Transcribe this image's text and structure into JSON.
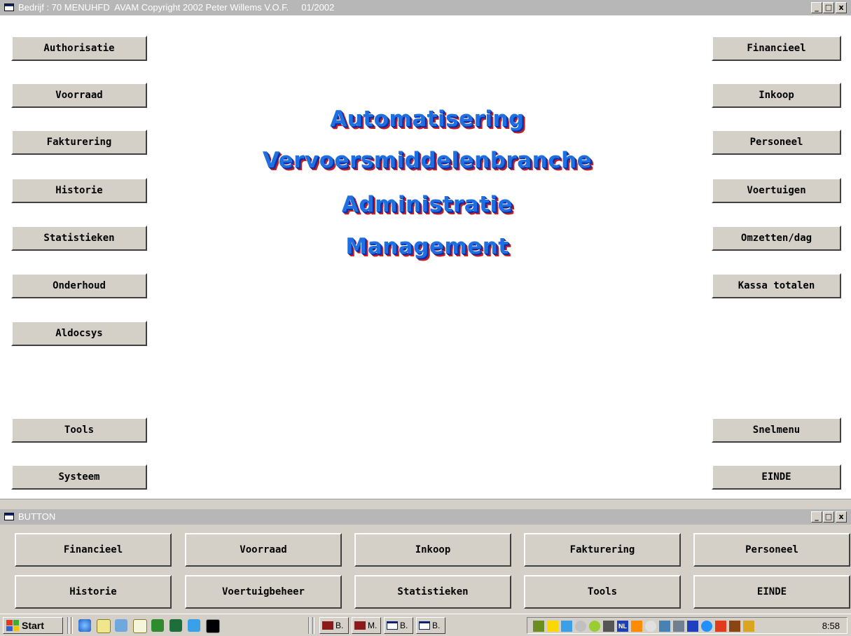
{
  "main_window": {
    "title": "Bedrijf : 70 MENUHFD  AVAM Copyright 2002 Peter Willems V.O.F.     01/2002",
    "controls": {
      "minimize": "_",
      "maximize": "□",
      "close": "x"
    },
    "left_buttons": [
      "Authorisatie",
      "Voorraad",
      "Fakturering",
      "Historie",
      "Statistieken",
      "Onderhoud",
      "Aldocsys",
      "Tools",
      "Systeem"
    ],
    "right_buttons": [
      "Financieel",
      "Inkoop",
      "Personeel",
      "Voertuigen",
      "Omzetten/dag",
      "Kassa totalen",
      "Snelmenu",
      "EINDE"
    ],
    "headlines": [
      "Automatisering",
      "Vervoersmiddelenbranche",
      "Administratie",
      "Management"
    ]
  },
  "button_window": {
    "title": "BUTTON",
    "controls": {
      "minimize": "_",
      "maximize": "□",
      "close": "x"
    },
    "rows": [
      [
        "Financieel",
        "Voorraad",
        "Inkoop",
        "Fakturering",
        "Personeel"
      ],
      [
        "Historie",
        "Voertuigbeheer",
        "Statistieken",
        "Tools",
        "EINDE"
      ]
    ]
  },
  "taskbar": {
    "start_label": "Start",
    "quick_launch_icons": [
      "ie-icon",
      "notepad-icon",
      "network-icon",
      "search-icon",
      "game-icon",
      "excel-icon",
      "phone-icon",
      "dos-icon"
    ],
    "tasks": [
      {
        "icon": "app-icon",
        "label": "B."
      },
      {
        "icon": "app-icon",
        "label": "M."
      },
      {
        "icon": "window-icon",
        "label": "B."
      },
      {
        "icon": "window-icon",
        "label": "B."
      }
    ],
    "tray_language": "NL",
    "clock": "8:58"
  },
  "colors": {
    "titlebar_inactive": "#b7b7b7",
    "button_face": "#d4d0c8",
    "headline_blue": "#1f6fe0",
    "headline_shadow_red": "#c81e1e"
  }
}
